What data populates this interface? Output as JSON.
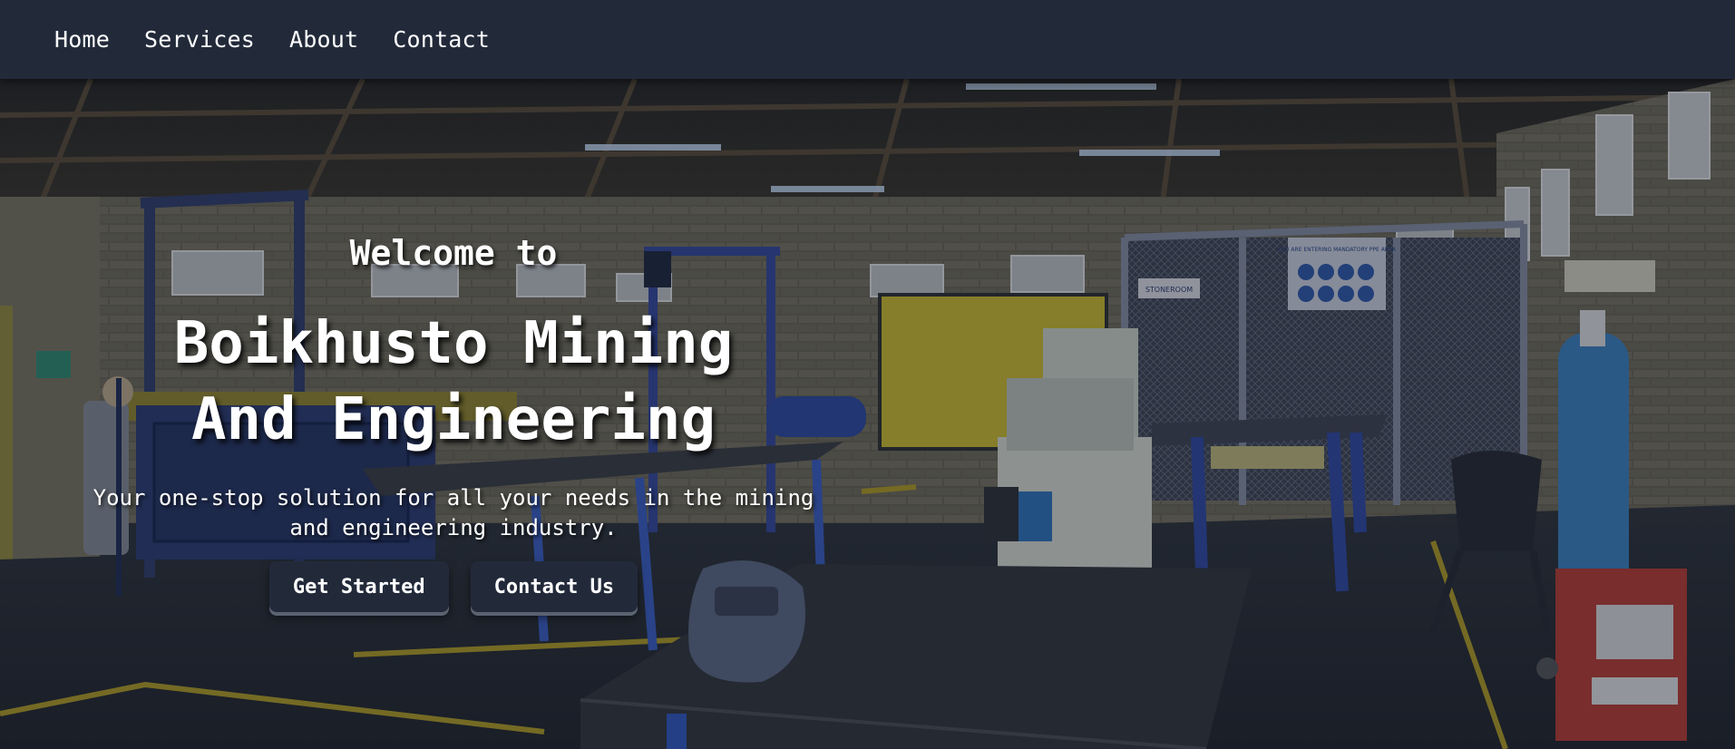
{
  "nav": {
    "items": [
      {
        "label": "Home"
      },
      {
        "label": "Services"
      },
      {
        "label": "About"
      },
      {
        "label": "Contact"
      }
    ]
  },
  "hero": {
    "welcome": "Welcome to",
    "title": "Boikhusto Mining And Engineering",
    "subtitle": "Your one-stop solution for all your needs in the mining and engineering industry.",
    "buttons": {
      "primary": "Get Started",
      "secondary": "Contact Us"
    },
    "background_image": "workshop-interior",
    "signage": {
      "stoneroom": "STONEROOM",
      "ppe_notice": "YOU ARE ENTERING MANDATORY PPE AREA"
    }
  },
  "colors": {
    "navbar": "#222a3a",
    "button": "#222a3a",
    "text": "#ffffff"
  }
}
